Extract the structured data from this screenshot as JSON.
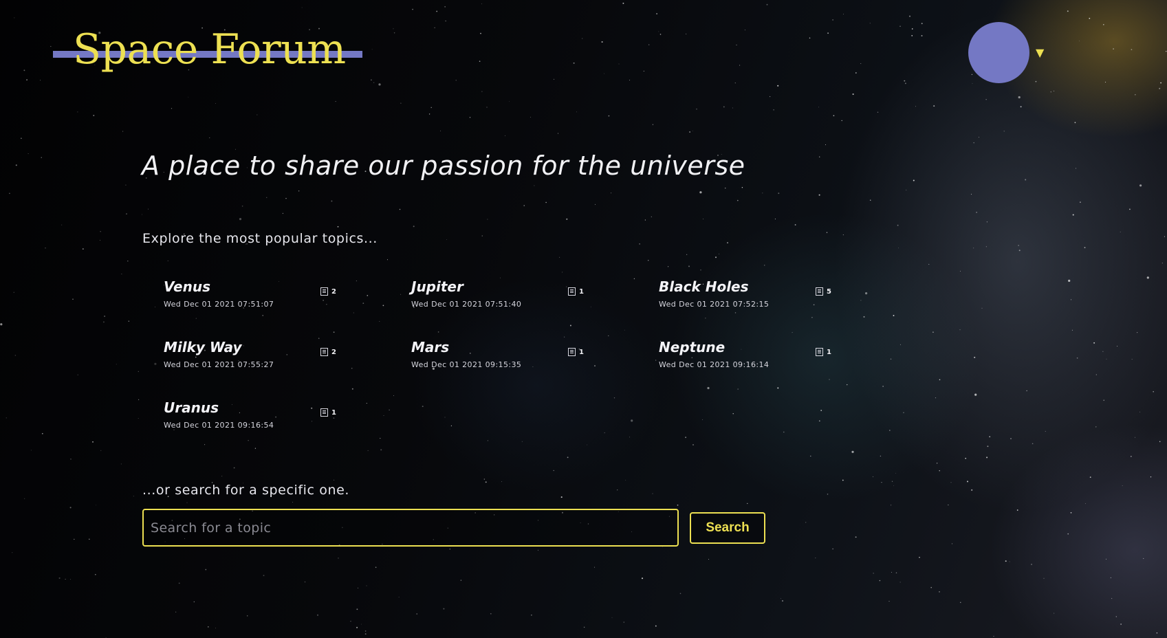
{
  "header": {
    "title": "Space Forum",
    "avatar_caret": "▼"
  },
  "main": {
    "tagline": "A place to share our passion for the universe",
    "explore_label": "Explore the most popular topics...",
    "topics": [
      {
        "name": "Venus",
        "date": "Wed Dec 01 2021 07:51:07",
        "count": "2"
      },
      {
        "name": "Jupiter",
        "date": "Wed Dec 01 2021 07:51:40",
        "count": "1"
      },
      {
        "name": "Black Holes",
        "date": "Wed Dec 01 2021 07:52:15",
        "count": "5"
      },
      {
        "name": "Milky Way",
        "date": "Wed Dec 01 2021 07:55:27",
        "count": "2"
      },
      {
        "name": "Mars",
        "date": "Wed Dec 01 2021 09:15:35",
        "count": "1"
      },
      {
        "name": "Neptune",
        "date": "Wed Dec 01 2021 09:16:14",
        "count": "1"
      },
      {
        "name": "Uranus",
        "date": "Wed Dec 01 2021 09:16:54",
        "count": "1"
      }
    ],
    "topic_count_icon": "document-icon",
    "search": {
      "hint": "...or search for a specific one.",
      "placeholder": "Search for a topic",
      "value": "",
      "button_label": "Search"
    }
  },
  "colors": {
    "accent_yellow": "#ede052",
    "accent_purple": "#7478c4",
    "background": "#050507"
  }
}
